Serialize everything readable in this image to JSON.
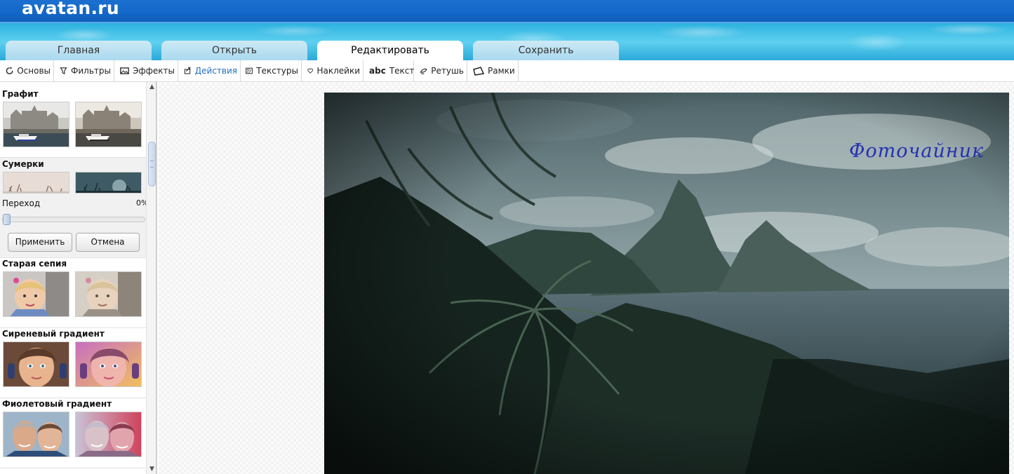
{
  "app": {
    "logo": "avatan.ru"
  },
  "tabs": [
    {
      "label": "Главная",
      "active": false
    },
    {
      "label": "Открыть",
      "active": false
    },
    {
      "label": "Редактировать",
      "active": true
    },
    {
      "label": "Сохранить",
      "active": false
    }
  ],
  "toolbar": {
    "items": [
      {
        "label": "Основы",
        "icon": "refresh-icon",
        "active": false
      },
      {
        "label": "Фильтры",
        "icon": "filter-icon",
        "active": false
      },
      {
        "label": "Эффекты",
        "icon": "picture-icon",
        "active": false
      },
      {
        "label": "Действия",
        "icon": "actions-icon",
        "active": true
      },
      {
        "label": "Текстуры",
        "icon": "texture-icon",
        "active": false
      },
      {
        "label": "Наклейки",
        "icon": "heart-icon",
        "active": false
      },
      {
        "label": "Текст",
        "icon": "text-abc-icon",
        "glyph": "abc",
        "active": false
      },
      {
        "label": "Ретушь",
        "icon": "retouch-icon",
        "active": false
      },
      {
        "label": "Рамки",
        "icon": "frame-icon",
        "active": false
      }
    ]
  },
  "panel": {
    "groups": [
      {
        "title": "Графит"
      },
      {
        "title": "Сумерки"
      },
      {
        "title": "Старая сепия"
      },
      {
        "title": "Сиреневый градиент"
      },
      {
        "title": "Фиолетовый градиент"
      }
    ],
    "transition": {
      "label": "Переход",
      "value_text": "0%",
      "value": 0
    },
    "apply_label": "Применить",
    "cancel_label": "Отмена"
  },
  "canvas": {
    "signature": "Фоточайник"
  },
  "colors": {
    "accent_blue": "#1f6fc7",
    "header_blue": "#1468c9",
    "water": "#2fb3e0"
  }
}
